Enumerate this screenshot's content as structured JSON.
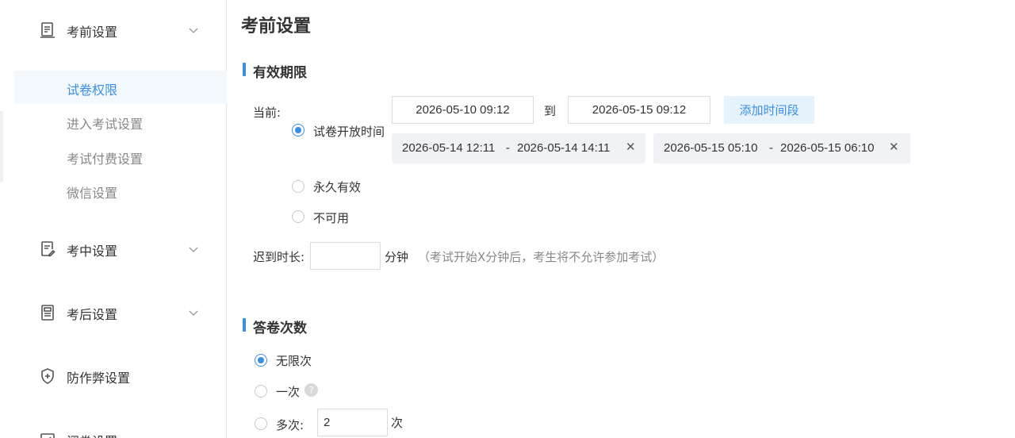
{
  "sidebar": {
    "groups": [
      {
        "label": "考前设置",
        "icon": "document-icon"
      },
      {
        "label": "考中设置",
        "icon": "edit-document-icon"
      },
      {
        "label": "考后设置",
        "icon": "score-sheet-icon"
      },
      {
        "label": "防作弊设置",
        "icon": "shield-icon"
      },
      {
        "label": "阅卷设置",
        "icon": "check-box-icon"
      }
    ],
    "sub_items": [
      {
        "label": "试卷权限",
        "active": true
      },
      {
        "label": "进入考试设置"
      },
      {
        "label": "考试付费设置"
      },
      {
        "label": "微信设置"
      }
    ]
  },
  "main": {
    "title": "考前设置",
    "validity": {
      "section_title": "有效期限",
      "current_label": "当前:",
      "start_value": "2026-05-10 09:12",
      "to_label": "到",
      "end_value": "2026-05-15 09:12",
      "add_button": "添加时间段",
      "options": [
        "试卷开放时间",
        "永久有效",
        "不可用"
      ],
      "selected": "试卷开放时间",
      "periods": [
        {
          "start": "2026-05-14 12:11",
          "sep": "-",
          "end": "2026-05-14 14:11"
        },
        {
          "start": "2026-05-15 05:10",
          "sep": "-",
          "end": "2026-05-15 06:10"
        }
      ],
      "late_label": "迟到时长:",
      "late_value": "",
      "late_unit": "分钟",
      "late_hint": "（考试开始X分钟后，考生将不允许参加考试）"
    },
    "attempts": {
      "section_title": "答卷次数",
      "options": [
        "无限次",
        "一次",
        "多次:"
      ],
      "selected": "无限次",
      "multi_value": "2",
      "multi_unit": "次"
    }
  },
  "colors": {
    "accent": "#3a8ee6",
    "active_bg": "#f4f9fe",
    "tag_bg": "#f0f2f5"
  }
}
